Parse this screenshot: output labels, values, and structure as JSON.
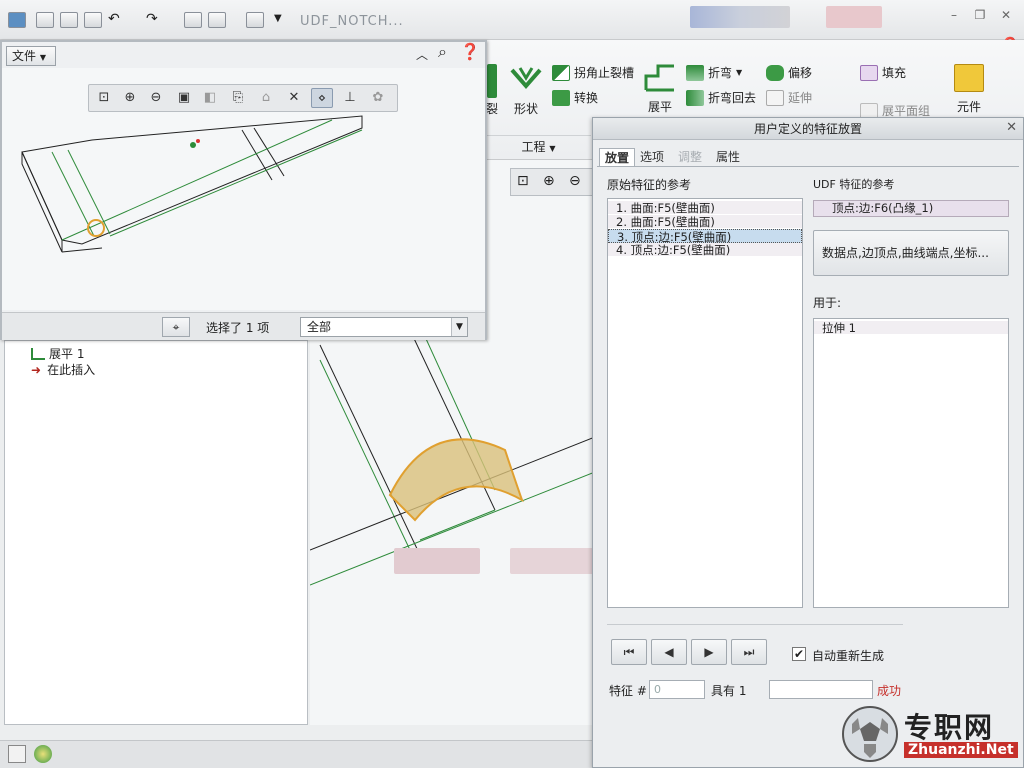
{
  "app": {
    "doc_title": "UDF_NOTCH...",
    "top_right_label": "元件"
  },
  "ribbon": {
    "items": {
      "corner_relief": "拐角止裂槽",
      "convert": "转换",
      "bend": "折弯",
      "bend_back": "折弯回去",
      "offset": "偏移",
      "extend": "延伸",
      "fill": "填充",
      "flat_patch": "展平面组",
      "rip": "裂",
      "shape": "形状",
      "flatten": "展平",
      "component": "元件"
    },
    "group_label": "工程"
  },
  "float_window": {
    "menu_label": "文件",
    "status_text": "选择了 1 项",
    "filter_value": "全部"
  },
  "tree": {
    "items": [
      {
        "label": "展平 1"
      },
      {
        "label": "在此插入"
      }
    ]
  },
  "dialog": {
    "title": "用户定义的特征放置",
    "tabs": [
      {
        "label": "放置",
        "state": "active"
      },
      {
        "label": "选项",
        "state": "normal"
      },
      {
        "label": "调整",
        "state": "disabled"
      },
      {
        "label": "属性",
        "state": "normal"
      }
    ],
    "orig_refs_label": "原始特征的参考",
    "orig_refs": [
      "1. 曲面:F5(壁曲面)",
      "2. 曲面:F5(壁曲面)",
      "3. 顶点:边:F5(壁曲面)",
      "4. 顶点:边:F5(壁曲面)"
    ],
    "selected_index": 2,
    "udf_refs_label": "UDF 特征的参考",
    "udf_ref_value": "顶点:边:F6(凸缘_1)",
    "filter_button": "数据点,边顶点,曲线端点,坐标...",
    "used_for_label": "用于:",
    "used_for_items": [
      "拉伸 1"
    ],
    "auto_regen_label": "自动重新生成",
    "feature_label": "特征 #",
    "feature_value": "0",
    "has_label": "具有 1",
    "status_text": "成功"
  },
  "watermark": {
    "brand": "专职网",
    "url": "Zhuanzhi.Net"
  },
  "colors": {
    "accent_green": "#2e8b3a",
    "selection_orange": "#e0a030",
    "status_red": "#c6302b"
  }
}
